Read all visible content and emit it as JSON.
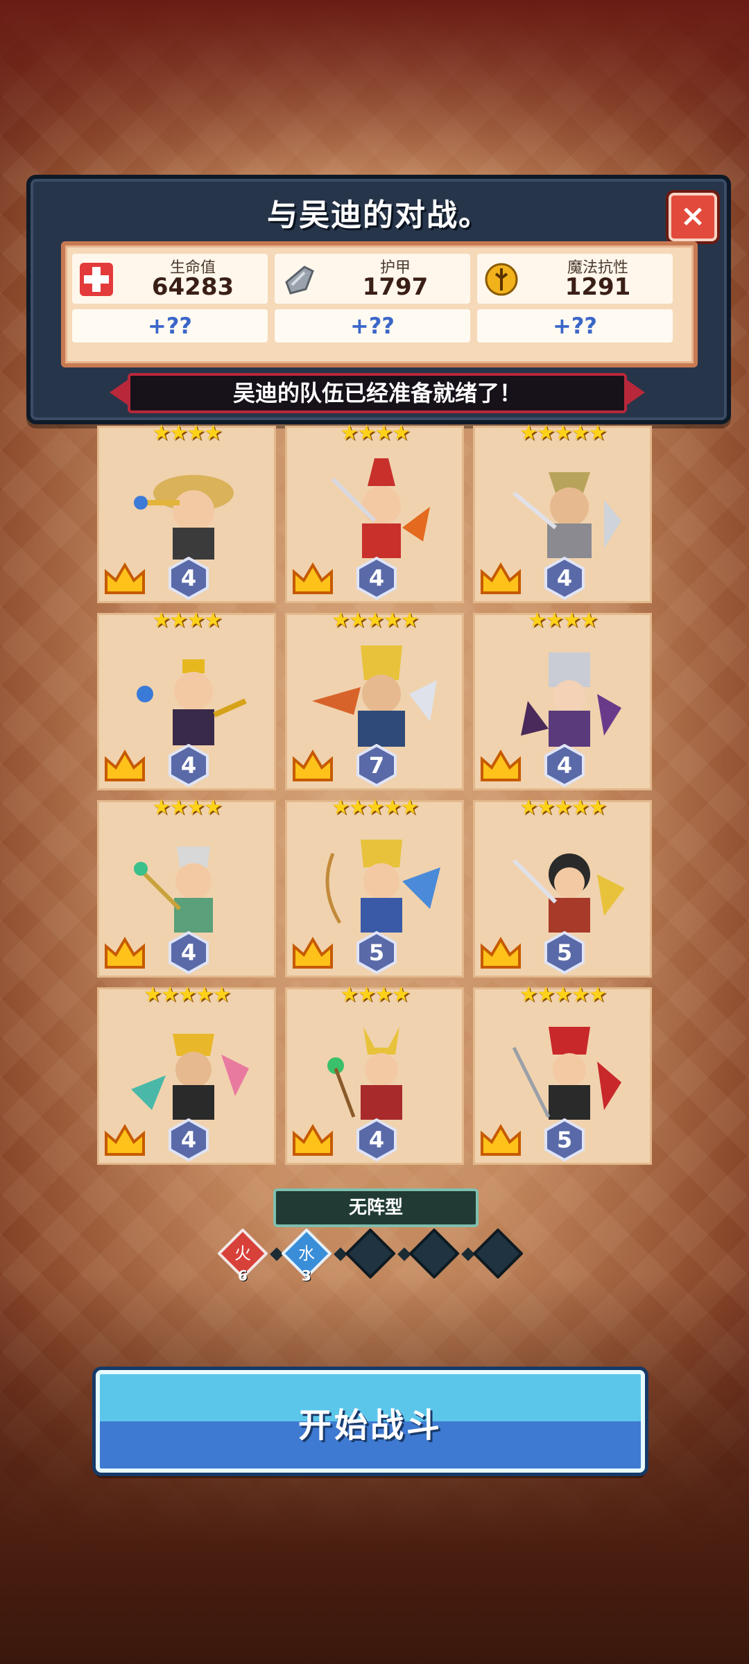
{
  "header": {
    "title": "与吴迪的对战。",
    "close_label": "×"
  },
  "stats": [
    {
      "label": "生命值",
      "value": "64283",
      "bonus": "+??",
      "icon": "health-cross-icon"
    },
    {
      "label": "护甲",
      "value": "1797",
      "bonus": "+??",
      "icon": "armor-shield-icon"
    },
    {
      "label": "魔法抗性",
      "value": "1291",
      "bonus": "+??",
      "icon": "magic-resist-icon"
    }
  ],
  "banner": "吴迪的队伍已经准备就绪了！",
  "heroes": [
    {
      "stars": "★★★★",
      "level": "4"
    },
    {
      "stars": "★★★★",
      "level": "4"
    },
    {
      "stars": "★★★★★",
      "level": "4"
    },
    {
      "stars": "★★★★",
      "level": "4"
    },
    {
      "stars": "★★★★★",
      "level": "7"
    },
    {
      "stars": "★★★★",
      "level": "4"
    },
    {
      "stars": "★★★★",
      "level": "4"
    },
    {
      "stars": "★★★★★",
      "level": "5"
    },
    {
      "stars": "★★★★★",
      "level": "5"
    },
    {
      "stars": "★★★★★",
      "level": "4"
    },
    {
      "stars": "★★★★",
      "level": "4"
    },
    {
      "stars": "★★★★★",
      "level": "5"
    }
  ],
  "formation": {
    "label": "无阵型",
    "gems": [
      {
        "glyph": "火",
        "count": "6",
        "color": "#d8403a"
      },
      {
        "glyph": "水",
        "count": "3",
        "color": "#3a8ed8"
      },
      {
        "glyph": "",
        "count": "",
        "color": "#1f3340"
      },
      {
        "glyph": "",
        "count": "",
        "color": "#1f3340"
      },
      {
        "glyph": "",
        "count": "",
        "color": "#1f3340"
      }
    ]
  },
  "start_button": "开始战斗"
}
